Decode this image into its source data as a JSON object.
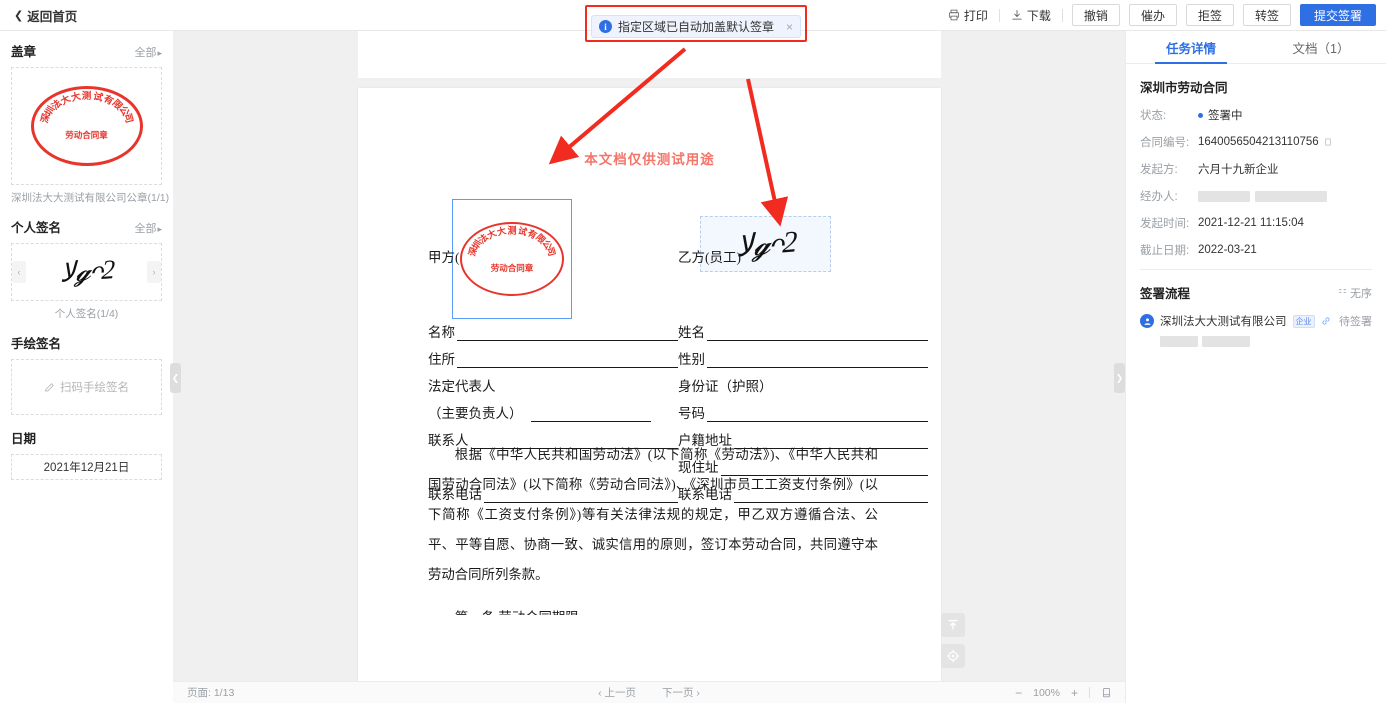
{
  "topbar": {
    "back_label": "返回首页",
    "back_chevron": "chevron-left-icon",
    "print_label": "打印",
    "download_label": "下载",
    "buttons": [
      {
        "label": "撤销",
        "primary": false
      },
      {
        "label": "催办",
        "primary": false
      },
      {
        "label": "拒签",
        "primary": false
      },
      {
        "label": "转签",
        "primary": false
      },
      {
        "label": "提交签署",
        "primary": true
      }
    ]
  },
  "notice": {
    "icon": "info-icon",
    "text": "指定区域已自动加盖默认签章",
    "close": "×",
    "highlight_color": "#f12b1f",
    "bg_color": "#eef3fd"
  },
  "sidebar_left": {
    "stamp": {
      "title": "盖章",
      "all_label": "全部",
      "caption": "深圳法大大测试有限公司公章(1/1)",
      "stamp_ring_text": "深圳法大大测试有限公司",
      "stamp_center_text": "劳动合同章",
      "stamp_color": "#e8352c"
    },
    "personal_sign": {
      "title": "个人签名",
      "all_label": "全部",
      "caption": "个人签名(1/4)",
      "prev": "‹",
      "next": "›"
    },
    "hand_sign": {
      "title": "手绘签名",
      "placeholder": "扫码手绘签名",
      "icon": "pencil-icon"
    },
    "date": {
      "title": "日期",
      "value": "2021年12月21日"
    }
  },
  "document": {
    "watermark_top": "本文档仅供测试用途",
    "watermark_inner": "本文档仅供测试用途",
    "party_a_label": "甲方(",
    "party_b_label": "乙方(员工)",
    "left_fields": [
      {
        "label": "名称",
        "line": true
      },
      {
        "label": "住所",
        "line": true
      },
      {
        "label": "法定代表人",
        "line": false
      },
      {
        "label": "（主要负责人）",
        "line": true,
        "short": true
      },
      {
        "label": "联系人",
        "line": true
      },
      {
        "label": "",
        "line": false
      },
      {
        "label": "联系电话",
        "line": true
      }
    ],
    "right_fields": [
      {
        "label": "姓名",
        "line": true
      },
      {
        "label": "性别",
        "line": true
      },
      {
        "label": "身份证（护照）",
        "line": false
      },
      {
        "label": "号码",
        "line": true
      },
      {
        "label": "户籍地址",
        "line": true
      },
      {
        "label": "现住址",
        "line": true
      },
      {
        "label": "联系电话",
        "line": true
      }
    ],
    "paragraph": "根据《中华人民共和国劳动法》(以下简称《劳动法》)、《中华人民共和国劳动合同法》(以下简称《劳动合同法》)、《深圳市员工工资支付条例》(以下简称《工资支付条例》)等有关法律法规的规定，甲乙双方遵循合法、公平、平等自愿、协商一致、诚实信用的原则，签订本劳动合同，共同遵守本劳动合同所列条款。",
    "paragraph_cut": "第一条 劳动合同期限",
    "stamp_ring_text": "深圳法大大测试有限公司",
    "stamp_center_text": "劳动合同章",
    "fab_top": "scroll-to-top-icon",
    "fab_locate": "locate-icon"
  },
  "bottombar": {
    "page_label": "页面:",
    "page_value": "1/13",
    "prev_page": "‹ 上一页",
    "next_page": "下一页 ›",
    "zoom_out": "−",
    "zoom_value": "100%",
    "zoom_in": "+",
    "fit_icon": "fit-page-icon"
  },
  "sidebar_right": {
    "tabs": [
      {
        "label": "任务详情",
        "active": true
      },
      {
        "label": "文档（1）",
        "active": false
      }
    ],
    "title": "深圳市劳动合同",
    "details": [
      {
        "key": "状态:",
        "value": "签署中",
        "type": "status"
      },
      {
        "key": "合同编号:",
        "value": "1640056504213110756",
        "type": "copyable"
      },
      {
        "key": "发起方:",
        "value": "六月十九新企业",
        "type": "text"
      },
      {
        "key": "经办人:",
        "value": "",
        "type": "redacted"
      },
      {
        "key": "发起时间:",
        "value": "2021-12-21 11:15:04",
        "type": "text"
      },
      {
        "key": "截止日期:",
        "value": "2022-03-21",
        "type": "text"
      }
    ],
    "flow": {
      "title": "签署流程",
      "mode_label": "无序",
      "mode_icon": "unordered-icon",
      "participant_name": "深圳法大大测试有限公司",
      "participant_badge": "企业",
      "link_icon": "link-icon",
      "participant_status": "待签署"
    }
  }
}
